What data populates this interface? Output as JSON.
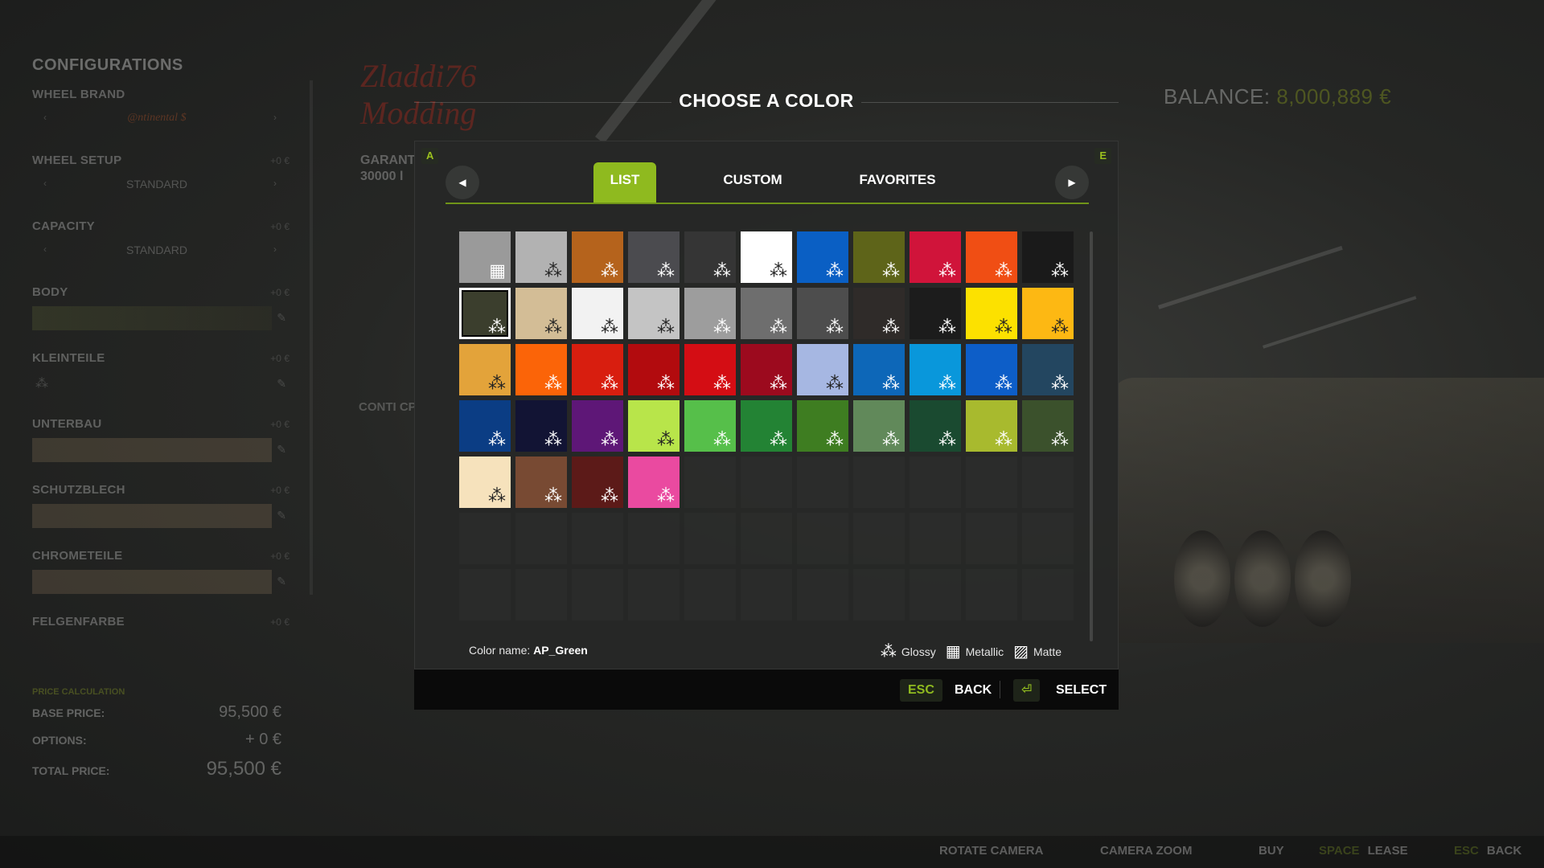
{
  "dialog": {
    "title": "CHOOSE A COLOR",
    "left_key": "A",
    "right_key": "E",
    "tabs": [
      {
        "label": "LIST",
        "active": true
      },
      {
        "label": "CUSTOM",
        "active": false
      },
      {
        "label": "FAVORITES",
        "active": false
      }
    ],
    "color_name_label": "Color name:",
    "color_name_value": "AP_Green",
    "legend": {
      "glossy": "Glossy",
      "metallic": "Metallic",
      "matte": "Matte"
    },
    "footer": {
      "back_key": "ESC",
      "back_label": "BACK",
      "select_key": "⏎",
      "select_label": "SELECT"
    },
    "selected_index": 11,
    "swatches": [
      {
        "color": "#9a9a9a",
        "finish": "metallic"
      },
      {
        "color": "#b2b2b2",
        "finish": "glossy"
      },
      {
        "color": "#b5631c",
        "finish": "glossy"
      },
      {
        "color": "#4b4b4f",
        "finish": "glossy"
      },
      {
        "color": "#353535",
        "finish": "glossy"
      },
      {
        "color": "#ffffff",
        "finish": "glossy"
      },
      {
        "color": "#0a5fc4",
        "finish": "glossy"
      },
      {
        "color": "#5e6419",
        "finish": "glossy"
      },
      {
        "color": "#d0143a",
        "finish": "glossy"
      },
      {
        "color": "#f04e14",
        "finish": "glossy"
      },
      {
        "color": "#1a1a1a",
        "finish": "glossy"
      },
      {
        "color": "#3b3e2d",
        "finish": "glossy"
      },
      {
        "color": "#d3bd96",
        "finish": "glossy"
      },
      {
        "color": "#f2f2f2",
        "finish": "glossy"
      },
      {
        "color": "#c4c4c4",
        "finish": "glossy"
      },
      {
        "color": "#9d9d9d",
        "finish": "glossy"
      },
      {
        "color": "#6e6e6e",
        "finish": "glossy"
      },
      {
        "color": "#4d4d4d",
        "finish": "glossy"
      },
      {
        "color": "#2f2b29",
        "finish": "glossy"
      },
      {
        "color": "#1c1c1c",
        "finish": "glossy"
      },
      {
        "color": "#fce100",
        "finish": "glossy"
      },
      {
        "color": "#fdb813",
        "finish": "glossy"
      },
      {
        "color": "#e3a33a",
        "finish": "glossy"
      },
      {
        "color": "#fb6408",
        "finish": "glossy"
      },
      {
        "color": "#d81e0f",
        "finish": "glossy"
      },
      {
        "color": "#b20b0e",
        "finish": "glossy"
      },
      {
        "color": "#d40d14",
        "finish": "glossy"
      },
      {
        "color": "#9c0a1e",
        "finish": "glossy"
      },
      {
        "color": "#a6b7e2",
        "finish": "glossy"
      },
      {
        "color": "#0d67b8",
        "finish": "glossy"
      },
      {
        "color": "#0997db",
        "finish": "glossy"
      },
      {
        "color": "#0d5ec8",
        "finish": "glossy"
      },
      {
        "color": "#234660",
        "finish": "glossy"
      },
      {
        "color": "#0b3d84",
        "finish": "glossy"
      },
      {
        "color": "#121434",
        "finish": "glossy"
      },
      {
        "color": "#5e1777",
        "finish": "glossy"
      },
      {
        "color": "#b8e54a",
        "finish": "glossy"
      },
      {
        "color": "#56bf4a",
        "finish": "glossy"
      },
      {
        "color": "#238334",
        "finish": "glossy"
      },
      {
        "color": "#3e7d21",
        "finish": "glossy"
      },
      {
        "color": "#61895a",
        "finish": "glossy"
      },
      {
        "color": "#1a4a30",
        "finish": "glossy"
      },
      {
        "color": "#a8ba2e",
        "finish": "glossy"
      },
      {
        "color": "#3b512c",
        "finish": "glossy"
      },
      {
        "color": "#f6e2bc",
        "finish": "glossy"
      },
      {
        "color": "#784a33",
        "finish": "glossy"
      },
      {
        "color": "#5c1a18",
        "finish": "glossy"
      },
      {
        "color": "#ea4aa0",
        "finish": "glossy"
      }
    ]
  },
  "background": {
    "config_title": "CONFIGURATIONS",
    "config_items": [
      {
        "label": "WHEEL BRAND",
        "value": "@ntinental $",
        "price": "",
        "kind": "brand"
      },
      {
        "label": "WHEEL SETUP",
        "value": "STANDARD",
        "price": "+0 €",
        "kind": "text"
      },
      {
        "label": "CAPACITY",
        "value": "STANDARD",
        "price": "+0 €",
        "kind": "text"
      },
      {
        "label": "BODY",
        "value": "",
        "price": "+0 €",
        "kind": "bar-green"
      },
      {
        "label": "KLEINTEILE",
        "value": "",
        "price": "+0 €",
        "kind": "icon"
      },
      {
        "label": "UNTERBAU",
        "value": "",
        "price": "+0 €",
        "kind": "bar"
      },
      {
        "label": "SCHUTZBLECH",
        "value": "",
        "price": "+0 €",
        "kind": "bar"
      },
      {
        "label": "CHROMETEILE",
        "value": "",
        "price": "+0 €",
        "kind": "bar"
      },
      {
        "label": "FELGENFARBE",
        "value": "",
        "price": "+0 €",
        "kind": "none"
      }
    ],
    "price_calc_label": "PRICE CALCULATION",
    "base_price_label": "BASE PRICE:",
    "base_price": "95,500 €",
    "options_label": "OPTIONS:",
    "options": "+ 0 €",
    "total_price_label": "TOTAL PRICE:",
    "total_price": "95,500 €",
    "logo_line1": "Zladdi76",
    "logo_line2": "Modding",
    "garant_line1": "GARANT",
    "garant_line2": "30000 l",
    "conti": "CONTI CP",
    "balance_label": "BALANCE:",
    "balance_value": "8,000,889 €"
  },
  "bottom_bar": [
    {
      "key": "",
      "label": "ROTATE CAMERA"
    },
    {
      "key": "",
      "label": "CAMERA ZOOM"
    },
    {
      "key": "",
      "label": "BUY"
    },
    {
      "key": "SPACE",
      "label": "LEASE"
    },
    {
      "key": "ESC",
      "label": "BACK"
    }
  ]
}
